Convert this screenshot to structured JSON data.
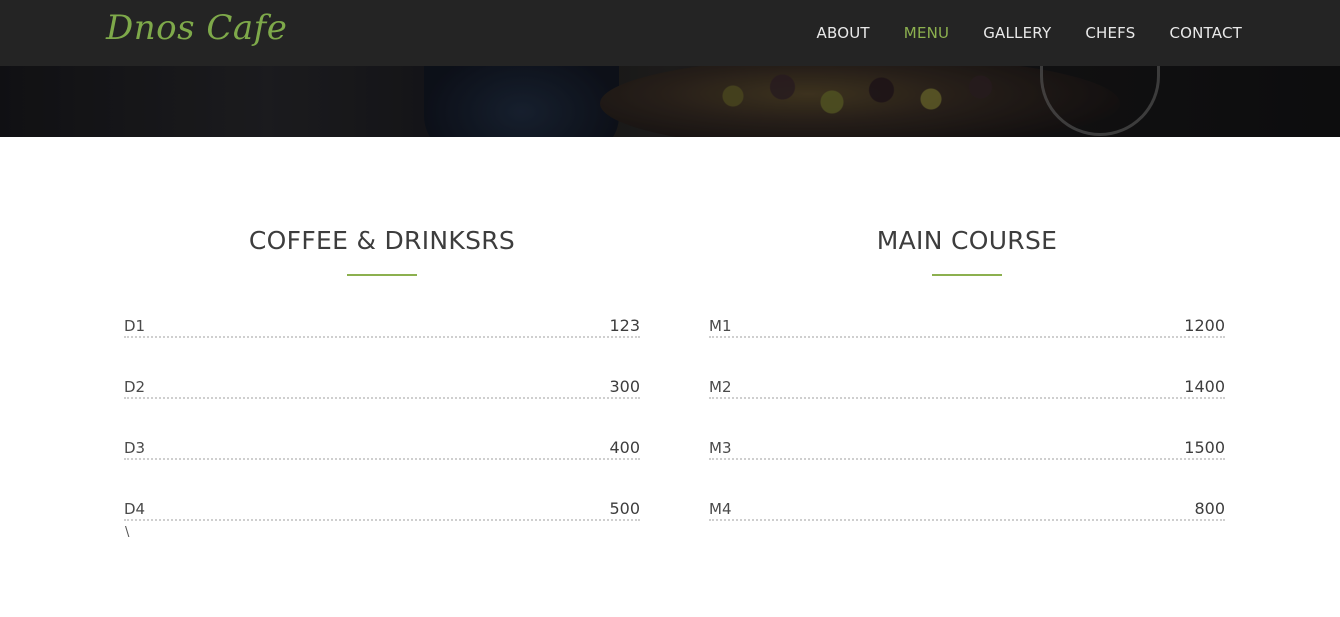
{
  "brand": "Dnos Cafe",
  "nav": {
    "items": [
      {
        "label": "ABOUT",
        "active": false
      },
      {
        "label": "MENU",
        "active": true
      },
      {
        "label": "GALLERY",
        "active": false
      },
      {
        "label": "CHEFS",
        "active": false
      },
      {
        "label": "CONTACT",
        "active": false
      }
    ]
  },
  "menu": {
    "left": {
      "title": "COFFEE & DRINKSRS",
      "items": [
        {
          "name": "D1",
          "price": "123"
        },
        {
          "name": "D2",
          "price": "300"
        },
        {
          "name": "D3",
          "price": "400"
        },
        {
          "name": "D4",
          "price": "500"
        }
      ]
    },
    "right": {
      "title": "MAIN COURSE",
      "items": [
        {
          "name": "M1",
          "price": "1200"
        },
        {
          "name": "M2",
          "price": "1400"
        },
        {
          "name": "M3",
          "price": "1500"
        },
        {
          "name": "M4",
          "price": "800"
        }
      ]
    }
  },
  "stray_text": "\\",
  "colors": {
    "accent": "#8cb04f",
    "navbar_bg": "#242424",
    "nav_text": "#e9e9e9",
    "body_text": "#4a4a4a"
  }
}
